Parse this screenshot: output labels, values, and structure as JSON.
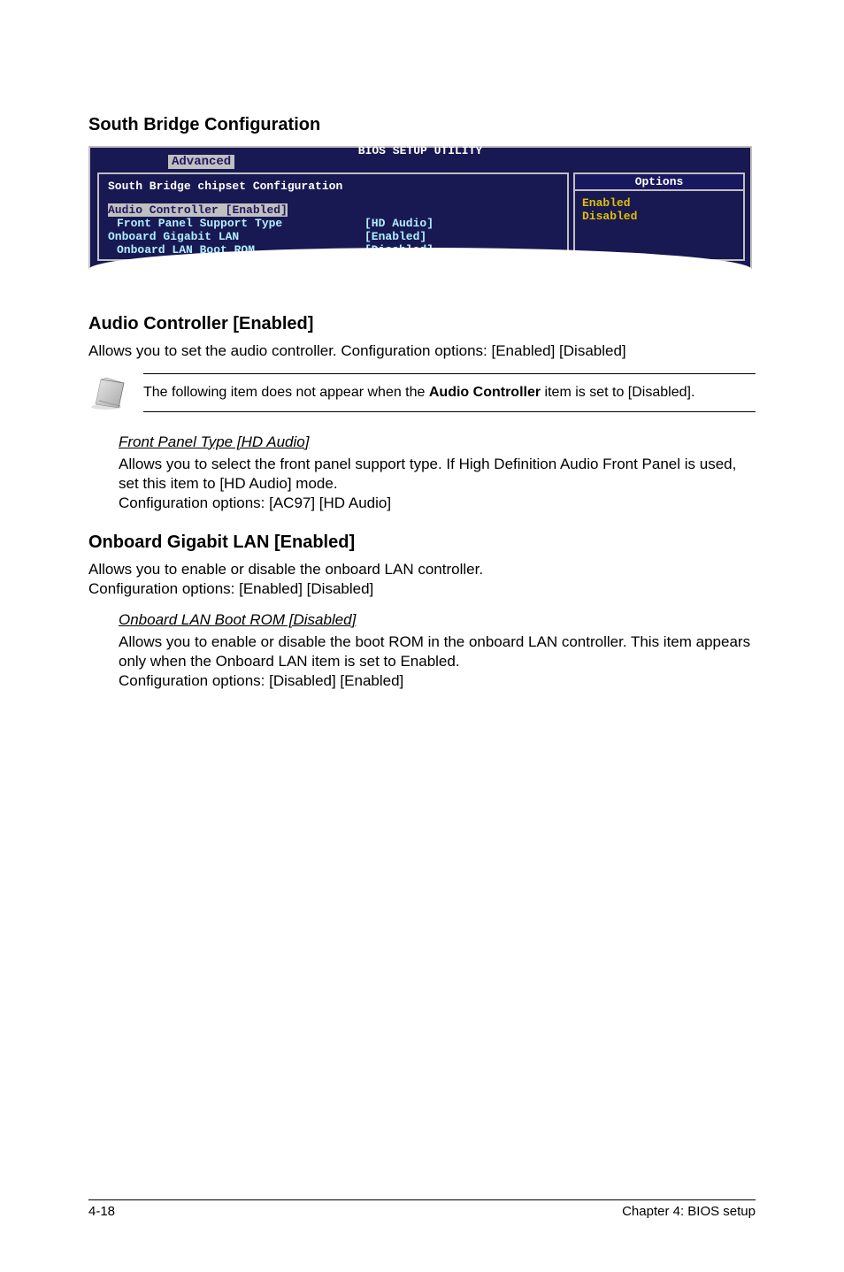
{
  "section_title": "South Bridge Configuration",
  "bios": {
    "title": "BIOS SETUP UTILITY",
    "tab": "Advanced",
    "panel_header": "South Bridge chipset Configuration",
    "rows": {
      "audio_controller": {
        "label": "Audio Controller",
        "value": "[Enabled]"
      },
      "front_panel": {
        "label": "Front Panel Support Type",
        "value": "[HD Audio]"
      },
      "gigabit_lan": {
        "label": "Onboard Gigabit LAN",
        "value": "[Enabled]"
      },
      "lan_boot_rom": {
        "label": "Onboard LAN Boot ROM",
        "value": "[Disabled]"
      }
    },
    "options_header": "Options",
    "options": {
      "opt1": "Enabled",
      "opt2": "Disabled"
    }
  },
  "audio_section": {
    "heading": "Audio Controller [Enabled]",
    "body": "Allows you to set the audio controller. Configuration options: [Enabled] [Disabled]"
  },
  "note": {
    "pre": "The following item does not appear when the ",
    "bold": "Audio Controller",
    "post": " item is set to [Disabled]."
  },
  "front_panel": {
    "title": "Front Panel Type [HD Audio]",
    "l1": "Allows you to select the front panel support type. If High Definition Audio Front Panel is used, set this item to [HD Audio] mode.",
    "l2": "Configuration options: [AC97] [HD Audio]"
  },
  "gigabit_section": {
    "heading": "Onboard Gigabit LAN [Enabled]",
    "l1": "Allows you to enable or disable the onboard LAN controller.",
    "l2": "Configuration options: [Enabled] [Disabled]"
  },
  "lan_boot": {
    "title": "Onboard LAN Boot ROM [Disabled]",
    "l1": "Allows you to enable or disable the boot ROM in the onboard LAN controller. This item appears only when the Onboard LAN item is set to Enabled.",
    "l2": "Configuration options: [Disabled] [Enabled]"
  },
  "footer": {
    "left": "4-18",
    "right": "Chapter 4: BIOS setup"
  }
}
